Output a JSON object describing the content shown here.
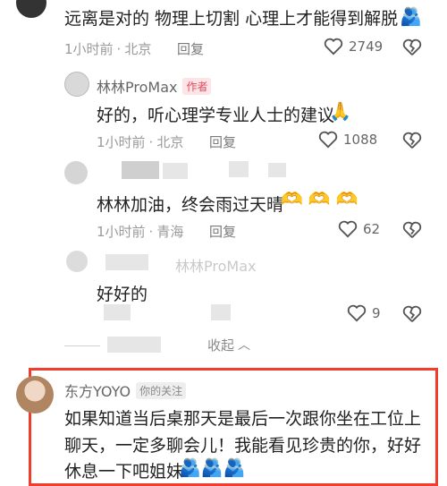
{
  "comments": [
    {
      "text": "远离是对的 物理上切割 心理上才能得到解脱",
      "time": "1小时前",
      "location": "北京",
      "reply": "回复",
      "likes": "2749"
    },
    {
      "name": "林林ProMax",
      "tag": "作者",
      "text": "好的，听心理学专业人士的建议",
      "time": "1小时前",
      "location": "北京",
      "reply": "回复",
      "likes": "1088"
    },
    {
      "text": "林林加油，终会雨过天晴",
      "time": "1小时前",
      "location": "青海",
      "reply": "回复",
      "likes": "62"
    },
    {
      "name_faded": "林林ProMax",
      "text": "好好的",
      "likes": "9"
    }
  ],
  "collapse": {
    "text": "收起"
  },
  "highlight": {
    "name": "东方YOYO",
    "tag": "你的关注",
    "line1": "如果知道当后桌那天是最后一次跟你坐在工位上",
    "line2": "聊天，一定多聊会儿！我能看见珍贵的你，好好",
    "line3": "休息一下吧姐妹"
  },
  "colors": {
    "accent_red": "#ef3e2d",
    "author_pink": "#e04a5f"
  }
}
